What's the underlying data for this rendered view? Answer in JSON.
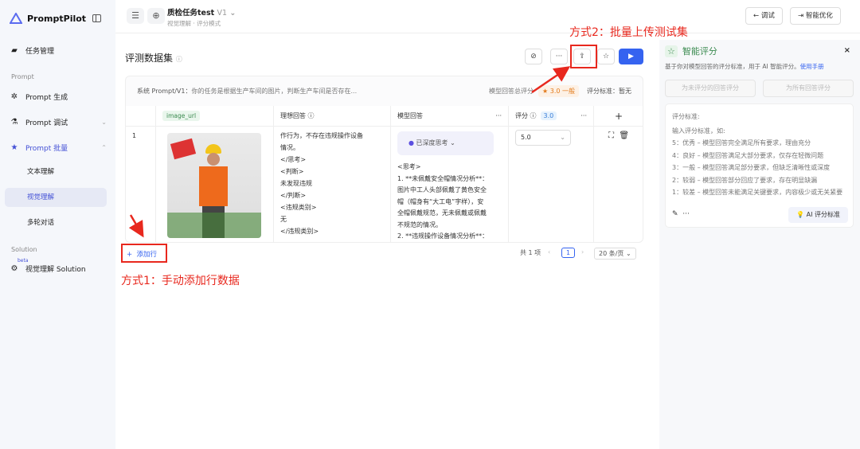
{
  "app": {
    "name": "PromptPilot"
  },
  "sidebar": {
    "task_mgmt": "任务管理",
    "section_prompt": "Prompt",
    "items": [
      {
        "label": "Prompt 生成"
      },
      {
        "label": "Prompt 调试"
      },
      {
        "label": "Prompt 批量"
      }
    ],
    "subitems": [
      {
        "label": "文本理解"
      },
      {
        "label": "视觉理解"
      },
      {
        "label": "多轮对话"
      }
    ],
    "section_solution": "Solution",
    "solution_badge": "beta",
    "solution_item": "视觉理解 Solution"
  },
  "header": {
    "title": "质检任务test",
    "version": "V1",
    "subtitle": "视觉理解 · 评分模式",
    "debug": "调试",
    "optimize": "智能优化"
  },
  "main": {
    "title": "评测数据集",
    "system_label": "系统 Prompt/V1：",
    "system_text": "你的任务是根据生产车间的图片，判断生产车间是否存在...",
    "total_score_label": "模型回答总评分",
    "total_score": "★ 3.0 一般",
    "criteria_label": "评分标准：暂无",
    "columns": {
      "image": "image_url",
      "ideal": "理想回答 ⓘ",
      "model": "模型回答",
      "score": "评分 ⓘ",
      "score_avg": "3.0",
      "more": "···",
      "add": "+"
    },
    "row": {
      "index": "1",
      "ideal_lines": [
        "作行为，不存在违规操作设备",
        "情况。",
        "</思考>",
        "<判断>",
        "未发现违规",
        "</判断>",
        "<违规类别>",
        "无",
        "</违规类别>"
      ],
      "thinking": "已深度思考",
      "model_lines": [
        "<思考>",
        "1. **未佩戴安全帽情况分析**：",
        "图片中工人头部佩戴了黄色安全",
        "帽（帽身有“大工电”字样），安",
        "全帽佩戴规范，无未佩戴或佩戴",
        "不规范的情况。",
        "2. **违规操作设备情况分析**："
      ],
      "score": "5.0"
    },
    "add_row": "添加行",
    "total": "共 1 项",
    "page": "1",
    "page_size": "20 条/页"
  },
  "panel": {
    "title": "智能评分",
    "desc": "基于你对模型回答的评分标准，用于 AI 智能评分。",
    "manual": "使用手册",
    "btn_unscored": "为未评分的回答评分",
    "btn_all": "为所有回答评分",
    "criteria_title": "评分标准:",
    "hint": "输入评分标准，如:",
    "lines": [
      "5：优秀 – 模型回答完全满足所有要求，理由充分",
      "4：良好 – 模型回答满足大部分要求，仅存在轻微问题",
      "3：一般 – 模型回答满足部分要求，但缺乏清晰性或深度",
      "2：较弱 – 模型回答部分回应了要求，存在明显缺漏",
      "1：较差 – 模型回答未能满足关键要求，内容极少或无关紧要"
    ],
    "ai_btn": "AI 评分标准"
  },
  "annotations": {
    "method2": "方式2：批量上传测试集",
    "method1": "方式1：手动添加行数据"
  }
}
